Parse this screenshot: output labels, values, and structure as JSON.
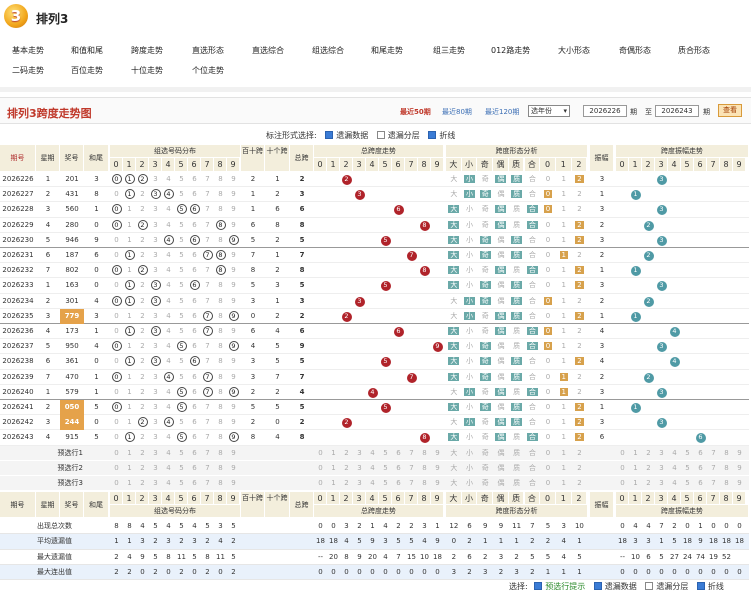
{
  "logo": {
    "char": "3"
  },
  "page_title": "排列3",
  "nav_row1": [
    "基本走势",
    "和值和尾",
    "跨度走势",
    "直选形态",
    "直选综合",
    "组选综合",
    "和尾走势",
    "组三走势",
    "012路走势",
    "大小形态",
    "奇偶形态",
    "质合形态"
  ],
  "nav_row2": [
    "二码走势",
    "百位走势",
    "十位走势",
    "个位走势"
  ],
  "chart_title": "排列3跨度走势图",
  "ranges": [
    "最近50期",
    "最近80期",
    "最近120期"
  ],
  "range_select": "选年份",
  "period_from": "2026226",
  "period_to": "2026243",
  "lbl_qi": "期",
  "lbl_zhi": "至",
  "query_btn": "查看",
  "opts": {
    "label": "标注形式选择:",
    "a": "遗漏数据",
    "b": "遗漏分层",
    "c": "折线"
  },
  "headers": {
    "qihao": "期号",
    "xingqi": "星期",
    "jianghao": "奖号",
    "hezhi": "和尾",
    "zuxuan": "组选号码分布",
    "bai": "百十跨",
    "shi": "十个跨",
    "zongkua": "总跨",
    "kuadu": "总跨度走势",
    "xingtai": "跨度形态分析",
    "zhenfu": "振幅",
    "zhenfu_zs": "跨度振幅走势"
  },
  "digits": [
    "0",
    "1",
    "2",
    "3",
    "4",
    "5",
    "6",
    "7",
    "8",
    "9"
  ],
  "xt_heads": [
    "大",
    "小",
    "奇",
    "偶",
    "质",
    "合",
    "0",
    "1",
    "2"
  ],
  "rows": [
    {
      "q": "2026226",
      "w": "1",
      "n": "201",
      "h": "3",
      "bk": "2",
      "sk": "1",
      "zk": "2",
      "z": "2",
      "zh": "3"
    },
    {
      "q": "2026227",
      "w": "2",
      "n": "431",
      "h": "8",
      "bk": "1",
      "sk": "2",
      "zk": "3",
      "z": "3",
      "zh": "1"
    },
    {
      "q": "2026228",
      "w": "3",
      "n": "560",
      "h": "1",
      "bk": "1",
      "sk": "6",
      "zk": "6",
      "z": "6",
      "zh": "3"
    },
    {
      "q": "2026229",
      "w": "4",
      "n": "280",
      "h": "0",
      "bk": "6",
      "sk": "8",
      "zk": "8",
      "z": "8",
      "zh": "2"
    },
    {
      "q": "2026230",
      "w": "5",
      "n": "946",
      "h": "9",
      "bk": "5",
      "sk": "2",
      "zk": "5",
      "z": "5",
      "zh": "3"
    },
    {
      "q": "2026231",
      "w": "6",
      "n": "187",
      "h": "6",
      "bk": "7",
      "sk": "1",
      "zk": "7",
      "z": "7",
      "zh": "2"
    },
    {
      "q": "2026232",
      "w": "7",
      "n": "802",
      "h": "0",
      "bk": "8",
      "sk": "2",
      "zk": "8",
      "z": "8",
      "zh": "1"
    },
    {
      "q": "2026233",
      "w": "1",
      "n": "163",
      "h": "0",
      "bk": "5",
      "sk": "3",
      "zk": "5",
      "z": "5",
      "zh": "3"
    },
    {
      "q": "2026234",
      "w": "2",
      "n": "301",
      "h": "4",
      "bk": "3",
      "sk": "1",
      "zk": "3",
      "z": "3",
      "zh": "2"
    },
    {
      "q": "2026235",
      "w": "3",
      "n": "779",
      "h": "3",
      "bk": "0",
      "sk": "2",
      "zk": "2",
      "z": "2",
      "zh": "1"
    },
    {
      "q": "2026236",
      "w": "4",
      "n": "173",
      "h": "1",
      "bk": "6",
      "sk": "4",
      "zk": "6",
      "z": "6",
      "zh": "4"
    },
    {
      "q": "2026237",
      "w": "5",
      "n": "950",
      "h": "4",
      "bk": "4",
      "sk": "5",
      "zk": "9",
      "z": "9",
      "zh": "3"
    },
    {
      "q": "2026238",
      "w": "6",
      "n": "361",
      "h": "0",
      "bk": "3",
      "sk": "5",
      "zk": "5",
      "z": "5",
      "zh": "4"
    },
    {
      "q": "2026239",
      "w": "7",
      "n": "470",
      "h": "1",
      "bk": "3",
      "sk": "7",
      "zk": "7",
      "z": "7",
      "zh": "2"
    },
    {
      "q": "2026240",
      "w": "1",
      "n": "579",
      "h": "1",
      "bk": "2",
      "sk": "2",
      "zk": "4",
      "z": "4",
      "zh": "3"
    },
    {
      "q": "2026241",
      "w": "2",
      "n": "050",
      "h": "5",
      "bk": "5",
      "sk": "5",
      "zk": "5",
      "z": "5",
      "zh": "1"
    },
    {
      "q": "2026242",
      "w": "3",
      "n": "244",
      "h": "0",
      "bk": "2",
      "sk": "0",
      "zk": "2",
      "z": "2",
      "zh": "3"
    },
    {
      "q": "2026243",
      "w": "4",
      "n": "915",
      "h": "5",
      "bk": "8",
      "sk": "4",
      "zk": "8",
      "z": "8",
      "zh": "6"
    }
  ],
  "yuxuan": [
    "预选行1",
    "预选行2",
    "预选行3"
  ],
  "stats": [
    {
      "label": "出现总次数",
      "zx": [
        "8",
        "8",
        "4",
        "5",
        "4",
        "5",
        "4",
        "5",
        "3",
        "5"
      ],
      "kd": [
        "0",
        "0",
        "3",
        "2",
        "1",
        "4",
        "2",
        "2",
        "3",
        "1"
      ],
      "xt": [
        "12",
        "6",
        "9",
        "9",
        "11",
        "7",
        "5",
        "3",
        "10"
      ],
      "zf": [
        "0",
        "4",
        "4",
        "7",
        "2",
        "0",
        "1",
        "0",
        "0",
        "0"
      ]
    },
    {
      "label": "平均遗漏值",
      "zx": [
        "1",
        "1",
        "3",
        "2",
        "3",
        "2",
        "3",
        "2",
        "4",
        "2"
      ],
      "kd": [
        "18",
        "18",
        "4",
        "5",
        "9",
        "3",
        "5",
        "5",
        "4",
        "9"
      ],
      "xt": [
        "0",
        "2",
        "1",
        "1",
        "1",
        "2",
        "2",
        "4",
        "1"
      ],
      "zf": [
        "18",
        "3",
        "3",
        "1",
        "5",
        "18",
        "9",
        "18",
        "18",
        "18"
      ]
    },
    {
      "label": "最大遗漏值",
      "zx": [
        "2",
        "4",
        "9",
        "5",
        "8",
        "11",
        "5",
        "8",
        "11",
        "5"
      ],
      "kd": [
        "--",
        "20",
        "8",
        "9",
        "20",
        "4",
        "7",
        "15",
        "10",
        "18"
      ],
      "xt": [
        "2",
        "6",
        "2",
        "3",
        "2",
        "5",
        "5",
        "4",
        "5"
      ],
      "zf": [
        "--",
        "10",
        "6",
        "5",
        "27",
        "24",
        "74",
        "19",
        "52",
        " "
      ]
    },
    {
      "label": "最大连出值",
      "zx": [
        "2",
        "2",
        "0",
        "2",
        "0",
        "2",
        "0",
        "2",
        "0",
        "2"
      ],
      "kd": [
        "0",
        "0",
        "0",
        "0",
        "0",
        "0",
        "0",
        "0",
        "0",
        "0"
      ],
      "xt": [
        "3",
        "2",
        "3",
        "2",
        "3",
        "2",
        "1",
        "1",
        "1"
      ],
      "zf": [
        "0",
        "0",
        "0",
        "0",
        "0",
        "0",
        "0",
        "0",
        "0",
        "0"
      ]
    }
  ],
  "footer": {
    "label": "选择:",
    "a": "预选行提示",
    "b": "遗漏数据",
    "c": "遗漏分层",
    "d": "折线"
  }
}
